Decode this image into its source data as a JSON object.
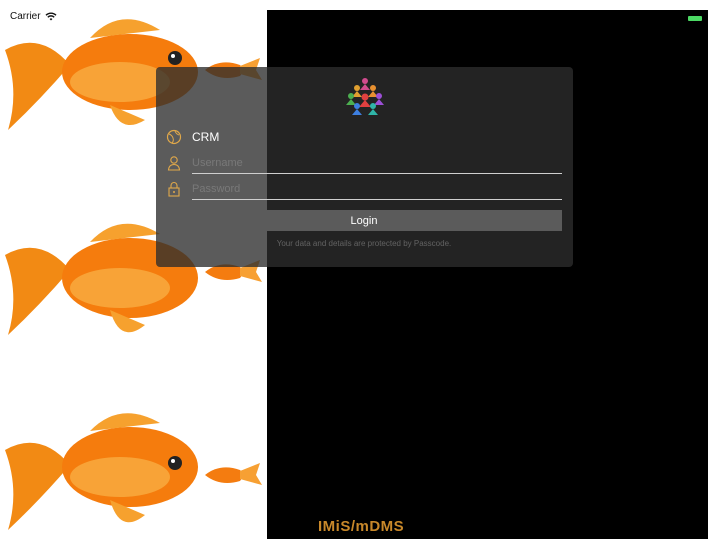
{
  "status_bar": {
    "carrier": "Carrier"
  },
  "login": {
    "app_name": "CRM",
    "username_placeholder": "Username",
    "password_placeholder": "Password",
    "login_label": "Login",
    "info_text": "Your data and details are protected by Passcode."
  },
  "footer": {
    "brand": "IMiS/mDMS"
  },
  "colors": {
    "accent": "#c8882a",
    "battery": "#4cd964",
    "card": "#2d2d2d"
  }
}
